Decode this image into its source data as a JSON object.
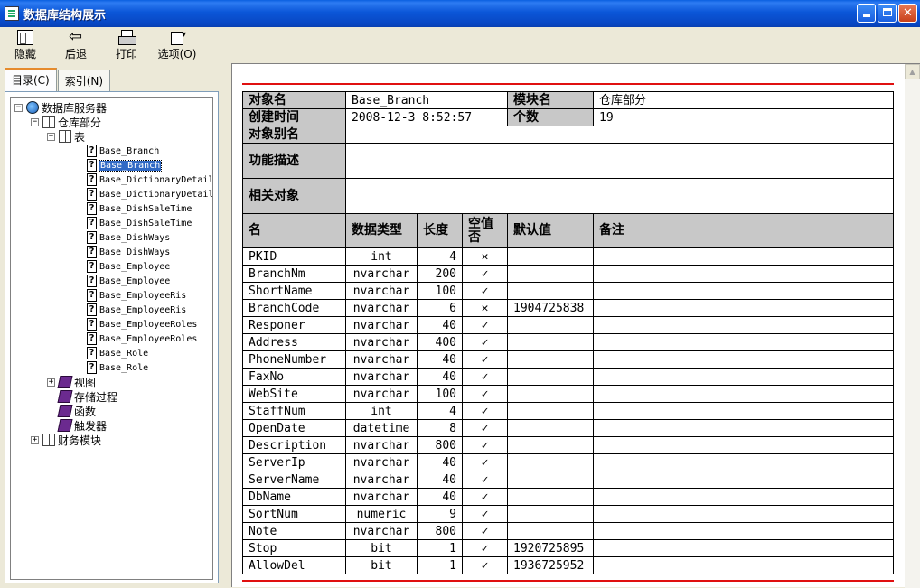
{
  "window": {
    "title": "数据库结构展示"
  },
  "toolbar": {
    "hide": "隐藏",
    "back": "后退",
    "print": "打印",
    "options": "选项(O)"
  },
  "tabs": {
    "contents": "目录(C)",
    "index": "索引(N)"
  },
  "tree": {
    "root": "数据库服务器",
    "warehouse": "仓库部分",
    "tables_node": "表",
    "tables": [
      "Base_Branch",
      "Base_Branch",
      "Base_DictionaryDetail",
      "Base_DictionaryDetail",
      "Base_DishSaleTime",
      "Base_DishSaleTime",
      "Base_DishWays",
      "Base_DishWays",
      "Base_Employee",
      "Base_Employee",
      "Base_EmployeeRis",
      "Base_EmployeeRis",
      "Base_EmployeeRoles",
      "Base_EmployeeRoles",
      "Base_Role",
      "Base_Role"
    ],
    "selected_index": 1,
    "views": "视图",
    "procs": "存储过程",
    "funcs": "函数",
    "triggers": "触发器",
    "finance": "财务模块"
  },
  "detail": {
    "object_name_label": "对象名",
    "object_name": "Base_Branch",
    "module_label": "模块名",
    "module": "仓库部分",
    "created_label": "创建时间",
    "created": "2008-12-3 8:52:57",
    "count_label": "个数",
    "count": "19",
    "alias_label": "对象别名",
    "alias": "",
    "desc_label": "功能描述",
    "desc": "",
    "related_label": "相关对象",
    "related": "",
    "columns": {
      "name": "名",
      "type": "数据类型",
      "length": "长度",
      "nullable": "空值否",
      "default": "默认值",
      "remark": "备注"
    },
    "rows": [
      {
        "name": "PKID",
        "type": "int",
        "length": "4",
        "nullable": "✕",
        "default": "",
        "remark": ""
      },
      {
        "name": "BranchNm",
        "type": "nvarchar",
        "length": "200",
        "nullable": "✓",
        "default": "",
        "remark": ""
      },
      {
        "name": "ShortName",
        "type": "nvarchar",
        "length": "100",
        "nullable": "✓",
        "default": "",
        "remark": ""
      },
      {
        "name": "BranchCode",
        "type": "nvarchar",
        "length": "6",
        "nullable": "✕",
        "default": "1904725838",
        "remark": ""
      },
      {
        "name": "Responer",
        "type": "nvarchar",
        "length": "40",
        "nullable": "✓",
        "default": "",
        "remark": ""
      },
      {
        "name": "Address",
        "type": "nvarchar",
        "length": "400",
        "nullable": "✓",
        "default": "",
        "remark": ""
      },
      {
        "name": "PhoneNumber",
        "type": "nvarchar",
        "length": "40",
        "nullable": "✓",
        "default": "",
        "remark": ""
      },
      {
        "name": "FaxNo",
        "type": "nvarchar",
        "length": "40",
        "nullable": "✓",
        "default": "",
        "remark": ""
      },
      {
        "name": "WebSite",
        "type": "nvarchar",
        "length": "100",
        "nullable": "✓",
        "default": "",
        "remark": ""
      },
      {
        "name": "StaffNum",
        "type": "int",
        "length": "4",
        "nullable": "✓",
        "default": "",
        "remark": ""
      },
      {
        "name": "OpenDate",
        "type": "datetime",
        "length": "8",
        "nullable": "✓",
        "default": "",
        "remark": ""
      },
      {
        "name": "Description",
        "type": "nvarchar",
        "length": "800",
        "nullable": "✓",
        "default": "",
        "remark": ""
      },
      {
        "name": "ServerIp",
        "type": "nvarchar",
        "length": "40",
        "nullable": "✓",
        "default": "",
        "remark": ""
      },
      {
        "name": "ServerName",
        "type": "nvarchar",
        "length": "40",
        "nullable": "✓",
        "default": "",
        "remark": ""
      },
      {
        "name": "DbName",
        "type": "nvarchar",
        "length": "40",
        "nullable": "✓",
        "default": "",
        "remark": ""
      },
      {
        "name": "SortNum",
        "type": "numeric",
        "length": "9",
        "nullable": "✓",
        "default": "",
        "remark": ""
      },
      {
        "name": "Note",
        "type": "nvarchar",
        "length": "800",
        "nullable": "✓",
        "default": "",
        "remark": ""
      },
      {
        "name": "Stop",
        "type": "bit",
        "length": "1",
        "nullable": "✓",
        "default": "1920725895",
        "remark": ""
      },
      {
        "name": "AllowDel",
        "type": "bit",
        "length": "1",
        "nullable": "✓",
        "default": "1936725952",
        "remark": ""
      }
    ]
  }
}
